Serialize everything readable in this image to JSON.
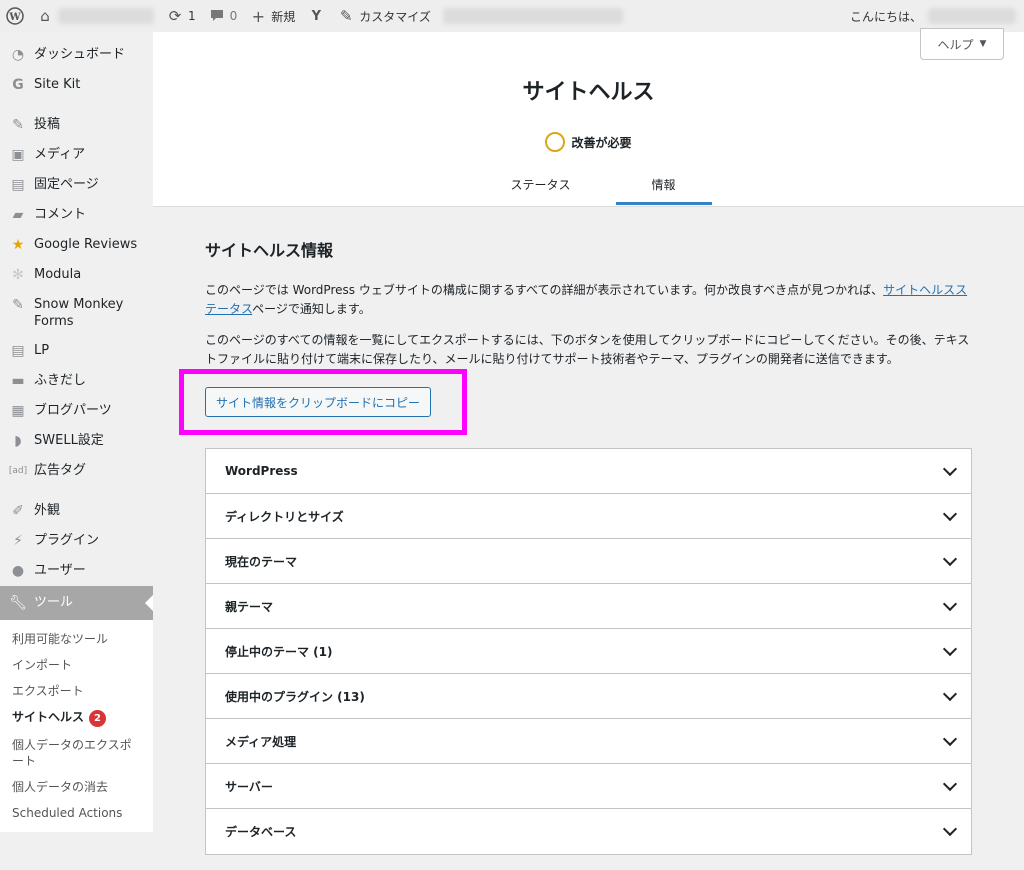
{
  "adminbar": {
    "updates_count": "1",
    "comments_count": "0",
    "new_label": "新規",
    "customize_label": "カスタマイズ",
    "greeting": "こんにちは、"
  },
  "sidebar": {
    "items": [
      {
        "label": "ダッシュボード",
        "icon": "dashboard-icon"
      },
      {
        "label": "Site Kit",
        "icon": "google-g-icon"
      },
      {
        "label": "投稿",
        "icon": "pin-icon"
      },
      {
        "label": "メディア",
        "icon": "media-icon"
      },
      {
        "label": "固定ページ",
        "icon": "page-icon"
      },
      {
        "label": "コメント",
        "icon": "comment-icon"
      },
      {
        "label": "Google Reviews",
        "icon": "star-icon"
      },
      {
        "label": "Modula",
        "icon": "modula-icon"
      },
      {
        "label": "Snow Monkey Forms",
        "icon": "pin-icon"
      },
      {
        "label": "LP",
        "icon": "page-icon"
      },
      {
        "label": "ふきだし",
        "icon": "bubble-icon"
      },
      {
        "label": "ブログパーツ",
        "icon": "grid-icon"
      },
      {
        "label": "SWELL設定",
        "icon": "swell-icon"
      },
      {
        "label": "広告タグ",
        "icon": "ad-icon"
      },
      {
        "label": "外観",
        "icon": "brush-icon"
      },
      {
        "label": "プラグイン",
        "icon": "plugin-icon"
      },
      {
        "label": "ユーザー",
        "icon": "user-icon"
      },
      {
        "label": "ツール",
        "icon": "wrench-icon"
      }
    ],
    "submenu": [
      "利用可能なツール",
      "インポート",
      "エクスポート",
      "サイトヘルス",
      "個人データのエクスポート",
      "個人データの消去",
      "Scheduled Actions"
    ],
    "site_health_badge": "2"
  },
  "header": {
    "help_label": "ヘルプ",
    "title": "サイトヘルス",
    "status_text": "改善が必要",
    "tabs": [
      "ステータス",
      "情報"
    ],
    "status_color": "#dba617"
  },
  "content": {
    "section_title": "サイトヘルス情報",
    "para1_before": "このページでは WordPress ウェブサイトの構成に関するすべての詳細が表示されています。何か改良すべき点が見つかれば、",
    "para1_link": "サイトヘルスステータス",
    "para1_after": "ページで通知します。",
    "para2": "このページのすべての情報を一覧にしてエクスポートするには、下のボタンを使用してクリップボードにコピーしてください。その後、テキストファイルに貼り付けて端末に保存したり、メールに貼り付けてサポート技術者やテーマ、プラグインの開発者に送信できます。",
    "copy_button": "サイト情報をクリップボードにコピー",
    "highlight_color": "#ff00ff"
  },
  "accordion": [
    "WordPress",
    "ディレクトリとサイズ",
    "現在のテーマ",
    "親テーマ",
    "停止中のテーマ (1)",
    "使用中のプラグイン (13)",
    "メディア処理",
    "サーバー",
    "データベース"
  ]
}
